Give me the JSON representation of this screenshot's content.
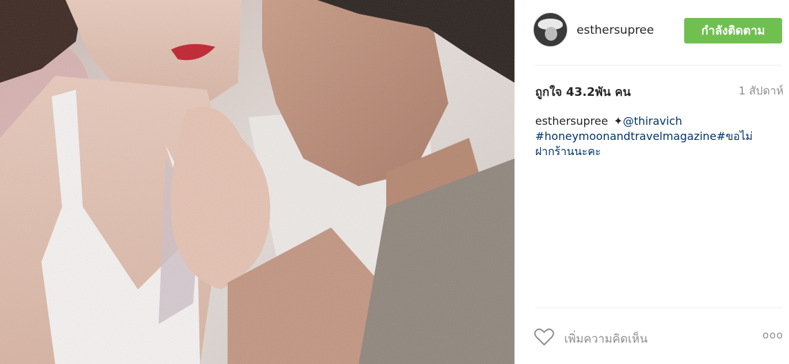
{
  "post": {
    "username": "esthersupree",
    "follow_label": "กำลังติดตาม",
    "likes": "ถูกใจ 43.2พัน คน",
    "timestamp": "1 สัปดาห์",
    "caption": {
      "username": "esthersupree",
      "sparkle": "✦",
      "mention": "@thiravich",
      "hashtag_main": "#honeymoonandtravelmagazine",
      "hashtag_thai": "#ขอไม่ฝากร้านนะคะ"
    },
    "comment_placeholder": "เพิ่มความคิดเห็น",
    "more_label": "ooo"
  },
  "colors": {
    "follow_button": "#70c050",
    "link": "#003569",
    "muted": "#8e8e8e"
  },
  "icons": {
    "like": "heart-outline-icon",
    "more": "more-options-icon"
  }
}
